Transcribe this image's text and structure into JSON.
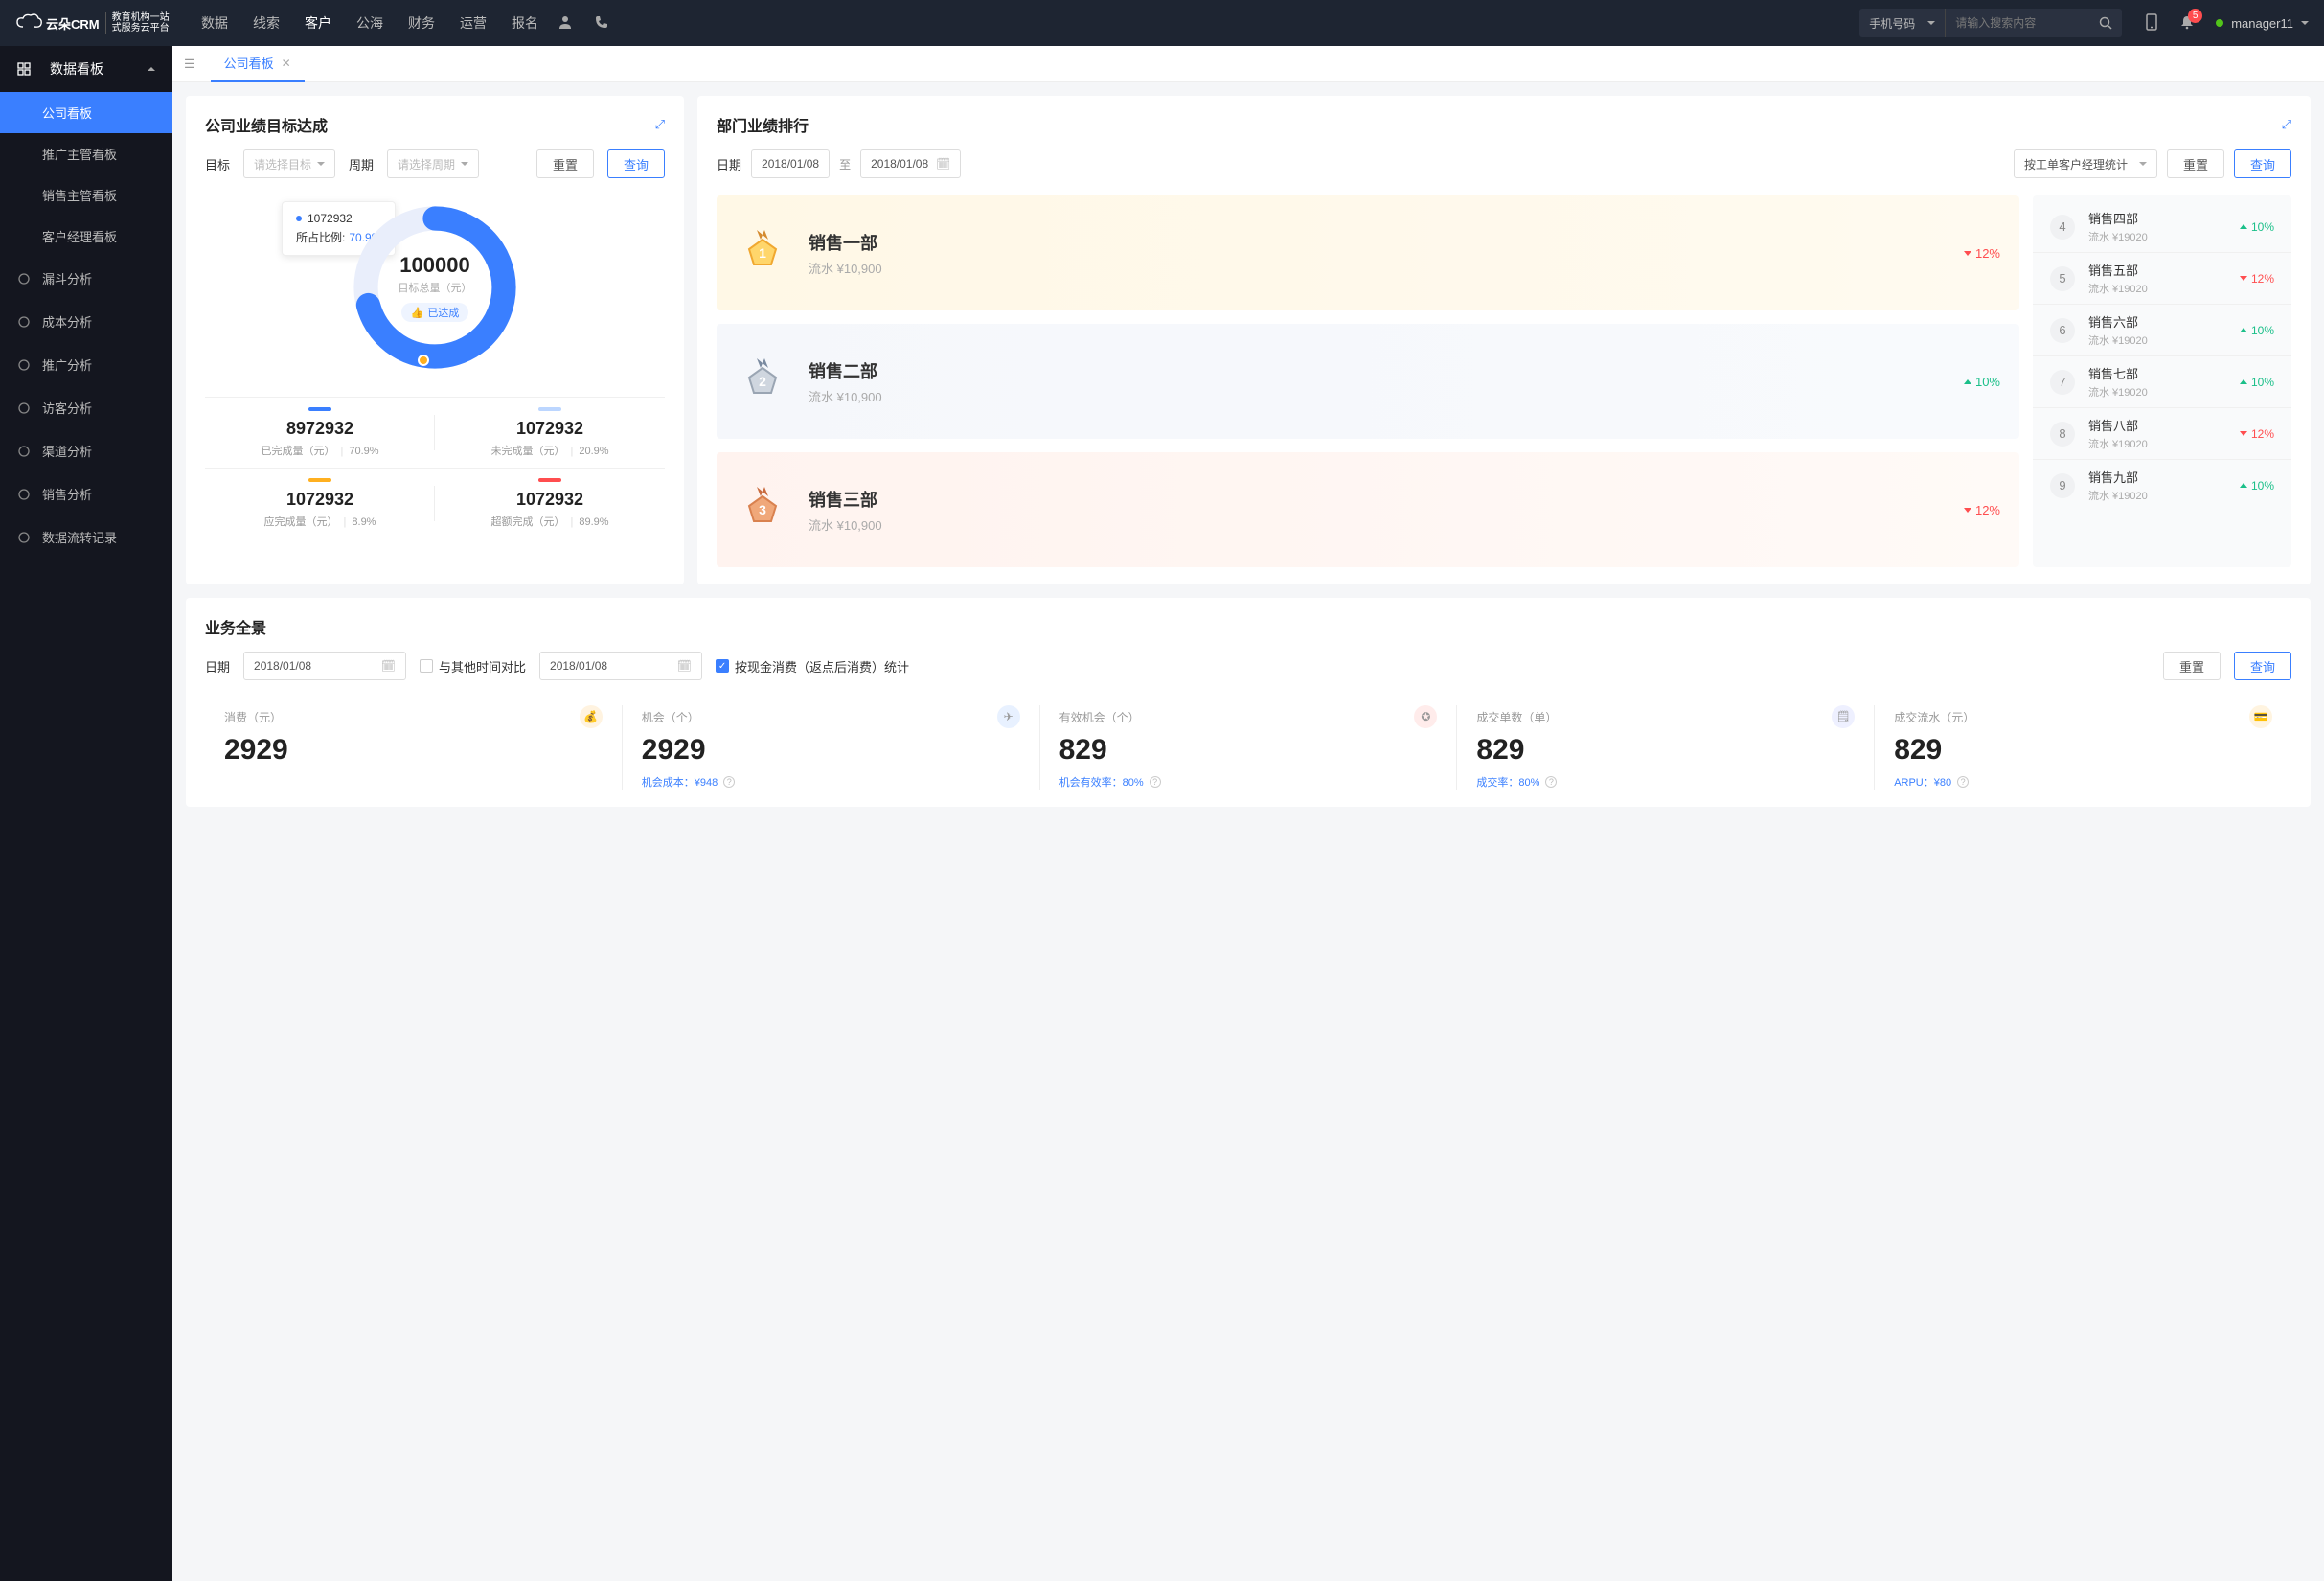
{
  "brand": {
    "name": "云朵CRM",
    "sub1": "教育机构一站",
    "sub2": "式服务云平台"
  },
  "topnav": {
    "items": [
      "数据",
      "线索",
      "客户",
      "公海",
      "财务",
      "运营",
      "报名"
    ],
    "active_index": 2,
    "search_type": "手机号码",
    "search_placeholder": "请输入搜索内容",
    "badge": "5",
    "user": "manager11"
  },
  "sidebar": {
    "group_title": "数据看板",
    "subs": [
      "公司看板",
      "推广主管看板",
      "销售主管看板",
      "客户经理看板"
    ],
    "active_sub_index": 0,
    "items": [
      "漏斗分析",
      "成本分析",
      "推广分析",
      "访客分析",
      "渠道分析",
      "销售分析",
      "数据流转记录"
    ]
  },
  "tab": {
    "label": "公司看板"
  },
  "goal_card": {
    "title": "公司业绩目标达成",
    "filter": {
      "goal_label": "目标",
      "goal_placeholder": "请选择目标",
      "period_label": "周期",
      "period_placeholder": "请选择周期",
      "reset": "重置",
      "query": "查询"
    },
    "tooltip": {
      "value": "1072932",
      "ratio_label": "所占比例:",
      "ratio": "70.9%"
    },
    "donut": {
      "center_value": "100000",
      "center_sub": "目标总量（元）",
      "tag": "已达成",
      "percent": 70.9
    },
    "stats": [
      {
        "dash_color": "#3a7fff",
        "value": "8972932",
        "label": "已完成量（元）",
        "pct": "70.9%"
      },
      {
        "dash_color": "#bcd6ff",
        "value": "1072932",
        "label": "未完成量（元）",
        "pct": "20.9%"
      },
      {
        "dash_color": "#ffb020",
        "value": "1072932",
        "label": "应完成量（元）",
        "pct": "8.9%"
      },
      {
        "dash_color": "#ff4d4f",
        "value": "1072932",
        "label": "超额完成（元）",
        "pct": "89.9%"
      }
    ]
  },
  "rank_card": {
    "title": "部门业绩排行",
    "filter": {
      "date_label": "日期",
      "from": "2018/01/08",
      "to_sep": "至",
      "to": "2018/01/08",
      "stat_type": "按工单客户经理统计",
      "reset": "重置",
      "query": "查询"
    },
    "top3": [
      {
        "name": "销售一部",
        "rev": "流水 ¥10,900",
        "pct": "12%",
        "dir": "down",
        "medal": "gold"
      },
      {
        "name": "销售二部",
        "rev": "流水 ¥10,900",
        "pct": "10%",
        "dir": "up",
        "medal": "silver"
      },
      {
        "name": "销售三部",
        "rev": "流水 ¥10,900",
        "pct": "12%",
        "dir": "down",
        "medal": "bronze"
      }
    ],
    "rest": [
      {
        "rank": "4",
        "name": "销售四部",
        "rev": "流水 ¥19020",
        "pct": "10%",
        "dir": "up"
      },
      {
        "rank": "5",
        "name": "销售五部",
        "rev": "流水 ¥19020",
        "pct": "12%",
        "dir": "down"
      },
      {
        "rank": "6",
        "name": "销售六部",
        "rev": "流水 ¥19020",
        "pct": "10%",
        "dir": "up"
      },
      {
        "rank": "7",
        "name": "销售七部",
        "rev": "流水 ¥19020",
        "pct": "10%",
        "dir": "up"
      },
      {
        "rank": "8",
        "name": "销售八部",
        "rev": "流水 ¥19020",
        "pct": "12%",
        "dir": "down"
      },
      {
        "rank": "9",
        "name": "销售九部",
        "rev": "流水 ¥19020",
        "pct": "10%",
        "dir": "up"
      }
    ]
  },
  "overview_card": {
    "title": "业务全景",
    "filter": {
      "date_label": "日期",
      "date1": "2018/01/08",
      "compare_label": "与其他时间对比",
      "date2": "2018/01/08",
      "stat_label": "按现金消费（返点后消费）统计",
      "reset": "重置",
      "query": "查询"
    },
    "kpis": [
      {
        "label": "消费（元）",
        "value": "2929",
        "foot": "",
        "icon_bg": "#fff3e0",
        "icon_txt": "💰"
      },
      {
        "label": "机会（个）",
        "value": "2929",
        "foot": "机会成本：¥948",
        "icon_bg": "#e8f1ff",
        "icon_txt": "✈"
      },
      {
        "label": "有效机会（个）",
        "value": "829",
        "foot": "机会有效率：80%",
        "icon_bg": "#ffeceb",
        "icon_txt": "✪"
      },
      {
        "label": "成交单数（单）",
        "value": "829",
        "foot": "成交率：80%",
        "icon_bg": "#eef0ff",
        "icon_txt": "🗒"
      },
      {
        "label": "成交流水（元）",
        "value": "829",
        "foot": "ARPU：¥80",
        "icon_bg": "#fff4e0",
        "icon_txt": "💳"
      }
    ]
  },
  "chart_data": {
    "type": "pie",
    "title": "公司业绩目标达成",
    "total_label": "目标总量（元）",
    "total": 100000,
    "series": [
      {
        "name": "已完成量（元）",
        "value": 8972932,
        "pct": 70.9,
        "color": "#3a7fff"
      },
      {
        "name": "未完成量（元）",
        "value": 1072932,
        "pct": 20.9,
        "color": "#bcd6ff"
      },
      {
        "name": "应完成量（元）",
        "value": 1072932,
        "pct": 8.9,
        "color": "#ffb020"
      },
      {
        "name": "超额完成（元）",
        "value": 1072932,
        "pct": 89.9,
        "color": "#ff4d4f"
      }
    ],
    "donut_highlight": {
      "value": 1072932,
      "ratio": 70.9
    }
  }
}
